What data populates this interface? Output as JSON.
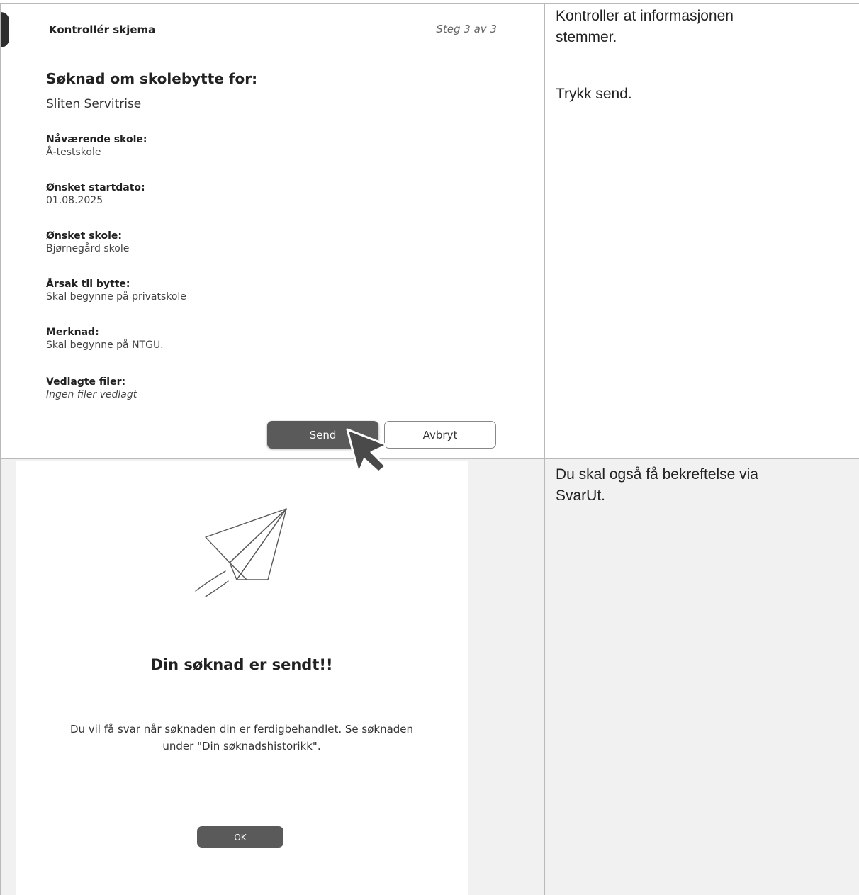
{
  "form": {
    "header_title": "Kontrollér skjema",
    "step_label": "Steg 3 av 3",
    "title": "Søknad om skolebytte for:",
    "applicant_name": "Sliten Servitrise",
    "fields": [
      {
        "label": "Nåværende skole:",
        "value": "Å-testskole"
      },
      {
        "label": "Ønsket startdato:",
        "value": "01.08.2025"
      },
      {
        "label": "Ønsket skole:",
        "value": "Bjørnegård skole"
      },
      {
        "label": "Årsak til bytte:",
        "value": "Skal begynne på privatskole"
      },
      {
        "label": "Merknad:",
        "value": "Skal begynne på NTGU."
      },
      {
        "label": "Vedlagte filer:",
        "value": "Ingen filer vedlagt"
      }
    ],
    "send_label": "Send",
    "cancel_label": "Avbryt"
  },
  "instructions": {
    "line1": "Kontroller at informasjonen",
    "line2": "stemmer.",
    "line3": "Trykk send.",
    "line4": "Du skal også få bekreftelse via",
    "line5": "SvarUt."
  },
  "confirmation": {
    "title": "Din søknad er sendt!!",
    "text": "Du vil få svar når søknaden din er ferdigbehandlet. Se søknaden under \"Din søknadshistorikk\".",
    "ok_label": "OK"
  },
  "icons": {
    "plane": "paper-plane-icon",
    "cursor": "mouse-pointer-icon"
  }
}
